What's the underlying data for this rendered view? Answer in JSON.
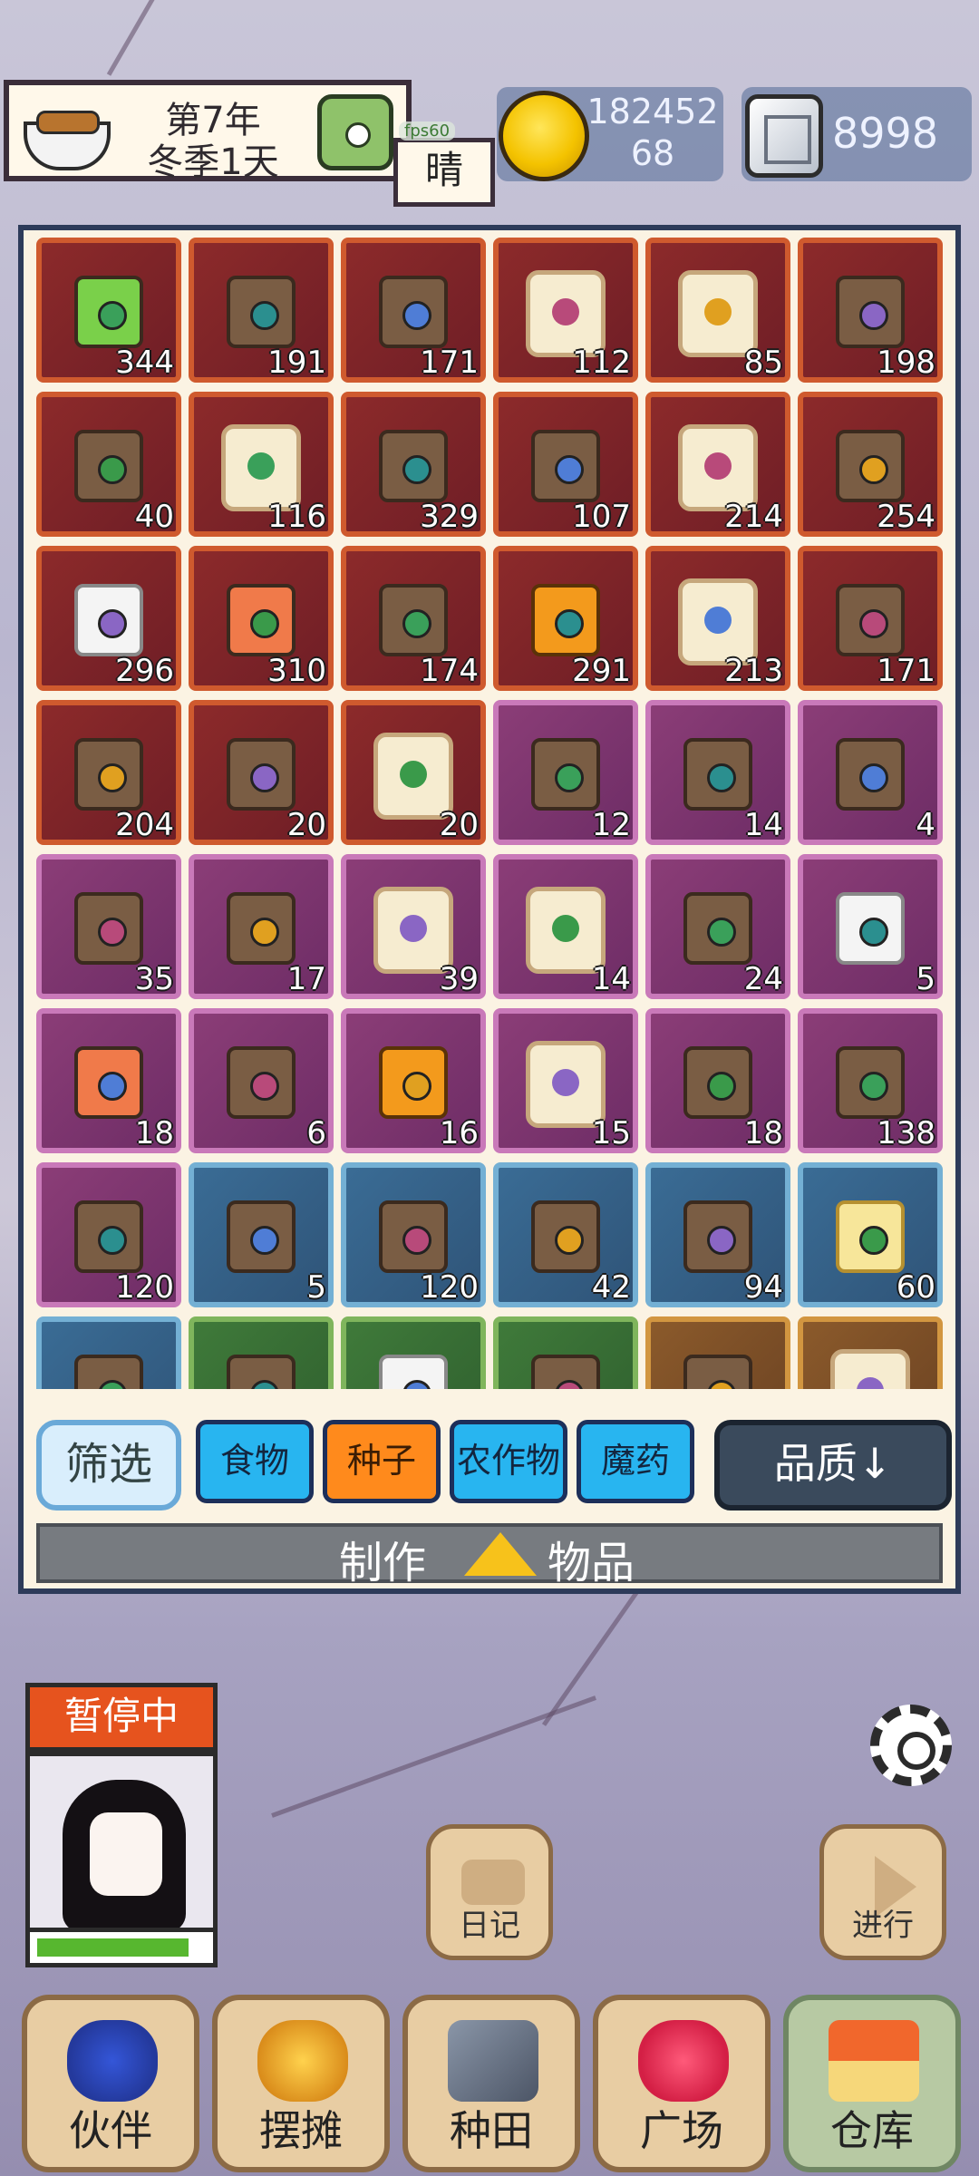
{
  "hud": {
    "year": "第7年",
    "season_day": "冬季1天",
    "weather": "晴",
    "fps": "fps60",
    "coins_line1": "182452",
    "coins_line2": "68",
    "gems": "8998"
  },
  "inventory": {
    "items": [
      {
        "qty": "344",
        "rarity": "red",
        "icon": "green-seed-pouch"
      },
      {
        "qty": "191",
        "rarity": "red",
        "icon": "seed-bag"
      },
      {
        "qty": "171",
        "rarity": "red",
        "icon": "seed-bag"
      },
      {
        "qty": "112",
        "rarity": "red",
        "icon": "star-seed-pack"
      },
      {
        "qty": "85",
        "rarity": "red",
        "icon": "seed-pack"
      },
      {
        "qty": "198",
        "rarity": "red",
        "icon": "seed-bag"
      },
      {
        "qty": "40",
        "rarity": "red",
        "icon": "seed-bag"
      },
      {
        "qty": "116",
        "rarity": "red",
        "icon": "seed-pack"
      },
      {
        "qty": "329",
        "rarity": "red",
        "icon": "seed-bag"
      },
      {
        "qty": "107",
        "rarity": "red",
        "icon": "seed-bag"
      },
      {
        "qty": "214",
        "rarity": "red",
        "icon": "seed-pack"
      },
      {
        "qty": "254",
        "rarity": "red",
        "icon": "seed-bag"
      },
      {
        "qty": "296",
        "rarity": "red",
        "icon": "white-sack"
      },
      {
        "qty": "310",
        "rarity": "red",
        "icon": "flower-seed-bag"
      },
      {
        "qty": "174",
        "rarity": "red",
        "icon": "seed-bag"
      },
      {
        "qty": "291",
        "rarity": "red",
        "icon": "orange-seed-packet"
      },
      {
        "qty": "213",
        "rarity": "red",
        "icon": "seed-pack"
      },
      {
        "qty": "171",
        "rarity": "red",
        "icon": "seed-bag"
      },
      {
        "qty": "204",
        "rarity": "red",
        "icon": "seed-bag"
      },
      {
        "qty": "20",
        "rarity": "red",
        "icon": "seed-bag"
      },
      {
        "qty": "20",
        "rarity": "red",
        "icon": "carrot-seed-pack"
      },
      {
        "qty": "12",
        "rarity": "purple",
        "icon": "seed-bag"
      },
      {
        "qty": "14",
        "rarity": "purple",
        "icon": "seed-bag"
      },
      {
        "qty": "4",
        "rarity": "purple",
        "icon": "seed-bag"
      },
      {
        "qty": "35",
        "rarity": "purple",
        "icon": "seed-bag"
      },
      {
        "qty": "17",
        "rarity": "purple",
        "icon": "seed-bag"
      },
      {
        "qty": "39",
        "rarity": "purple",
        "icon": "seed-pack"
      },
      {
        "qty": "14",
        "rarity": "purple",
        "icon": "seed-pack"
      },
      {
        "qty": "24",
        "rarity": "purple",
        "icon": "seed-bag"
      },
      {
        "qty": "5",
        "rarity": "purple",
        "icon": "white-sack"
      },
      {
        "qty": "18",
        "rarity": "purple",
        "icon": "flower-seed-bag"
      },
      {
        "qty": "6",
        "rarity": "purple",
        "icon": "seed-bag"
      },
      {
        "qty": "16",
        "rarity": "purple",
        "icon": "orange-seed-packet"
      },
      {
        "qty": "15",
        "rarity": "purple",
        "icon": "seed-pack"
      },
      {
        "qty": "18",
        "rarity": "purple",
        "icon": "seed-bag"
      },
      {
        "qty": "138",
        "rarity": "purple",
        "icon": "seed-bag"
      },
      {
        "qty": "120",
        "rarity": "purple",
        "icon": "seed-bag"
      },
      {
        "qty": "5",
        "rarity": "blue",
        "icon": "seed-bag"
      },
      {
        "qty": "120",
        "rarity": "blue",
        "icon": "seed-bag"
      },
      {
        "qty": "42",
        "rarity": "blue",
        "icon": "seed-bag"
      },
      {
        "qty": "94",
        "rarity": "blue",
        "icon": "seed-bag"
      },
      {
        "qty": "60",
        "rarity": "blue",
        "icon": "gold-sack"
      },
      {
        "qty": "",
        "rarity": "blue",
        "icon": "seed-bag"
      },
      {
        "qty": "",
        "rarity": "green",
        "icon": "seed-bag"
      },
      {
        "qty": "",
        "rarity": "green",
        "icon": "white-sack"
      },
      {
        "qty": "",
        "rarity": "green",
        "icon": "seed-bag"
      },
      {
        "qty": "",
        "rarity": "brown",
        "icon": "seed-bag"
      },
      {
        "qty": "",
        "rarity": "brown",
        "icon": "seed-pack"
      }
    ]
  },
  "filters": {
    "filter_label": "筛选",
    "tabs": [
      {
        "label": "食物",
        "active": false
      },
      {
        "label": "种子",
        "active": true
      },
      {
        "label": "农作物",
        "active": false
      },
      {
        "label": "魔药",
        "active": false
      }
    ],
    "sort_label": "品质↓"
  },
  "craft": {
    "left": "制作",
    "right": "物品"
  },
  "character": {
    "status": "暂停中",
    "hp_fraction": 0.9
  },
  "actions": {
    "diary": "日记",
    "go": "进行"
  },
  "nav": [
    {
      "label": "伙伴",
      "key": "partners"
    },
    {
      "label": "摆摊",
      "key": "stall"
    },
    {
      "label": "种田",
      "key": "farm"
    },
    {
      "label": "广场",
      "key": "plaza"
    },
    {
      "label": "仓库",
      "key": "warehouse",
      "active": true
    }
  ]
}
